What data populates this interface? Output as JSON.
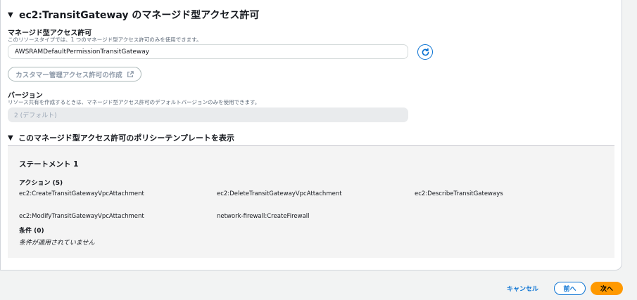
{
  "section": {
    "title": "ec2:TransitGateway のマネージド型アクセス許可"
  },
  "managed_permission": {
    "label": "マネージド型アクセス許可",
    "description": "このリソースタイプでは、1 つのマネージド型アクセス許可のみを使用できます。",
    "selected_value": "AWSRAMDefaultPermissionTransitGateway",
    "create_button_label": "カスタマー管理アクセス許可の作成"
  },
  "version": {
    "label": "バージョン",
    "description": "リソース共有を作成するときは、マネージド型アクセス許可のデフォルトバージョンのみを使用できます。",
    "selected_value": "2 (デフォルト)"
  },
  "policy_template": {
    "toggle_label": "このマネージド型アクセス許可のポリシーテンプレートを表示",
    "statement_title": "ステートメント 1",
    "actions_label": "アクション (5)",
    "actions": [
      "ec2:CreateTransitGatewayVpcAttachment",
      "ec2:DeleteTransitGatewayVpcAttachment",
      "ec2:DescribeTransitGateways",
      "ec2:ModifyTransitGatewayVpcAttachment",
      "network-firewall:CreateFirewall"
    ],
    "conditions_label": "条件 (0)",
    "conditions_value": "条件が適用されていません"
  },
  "footer": {
    "cancel_label": "キャンセル",
    "prev_label": "前へ",
    "next_label": "次へ"
  },
  "colors": {
    "accent_blue": "#0972d3",
    "primary_orange": "#ff9900"
  }
}
